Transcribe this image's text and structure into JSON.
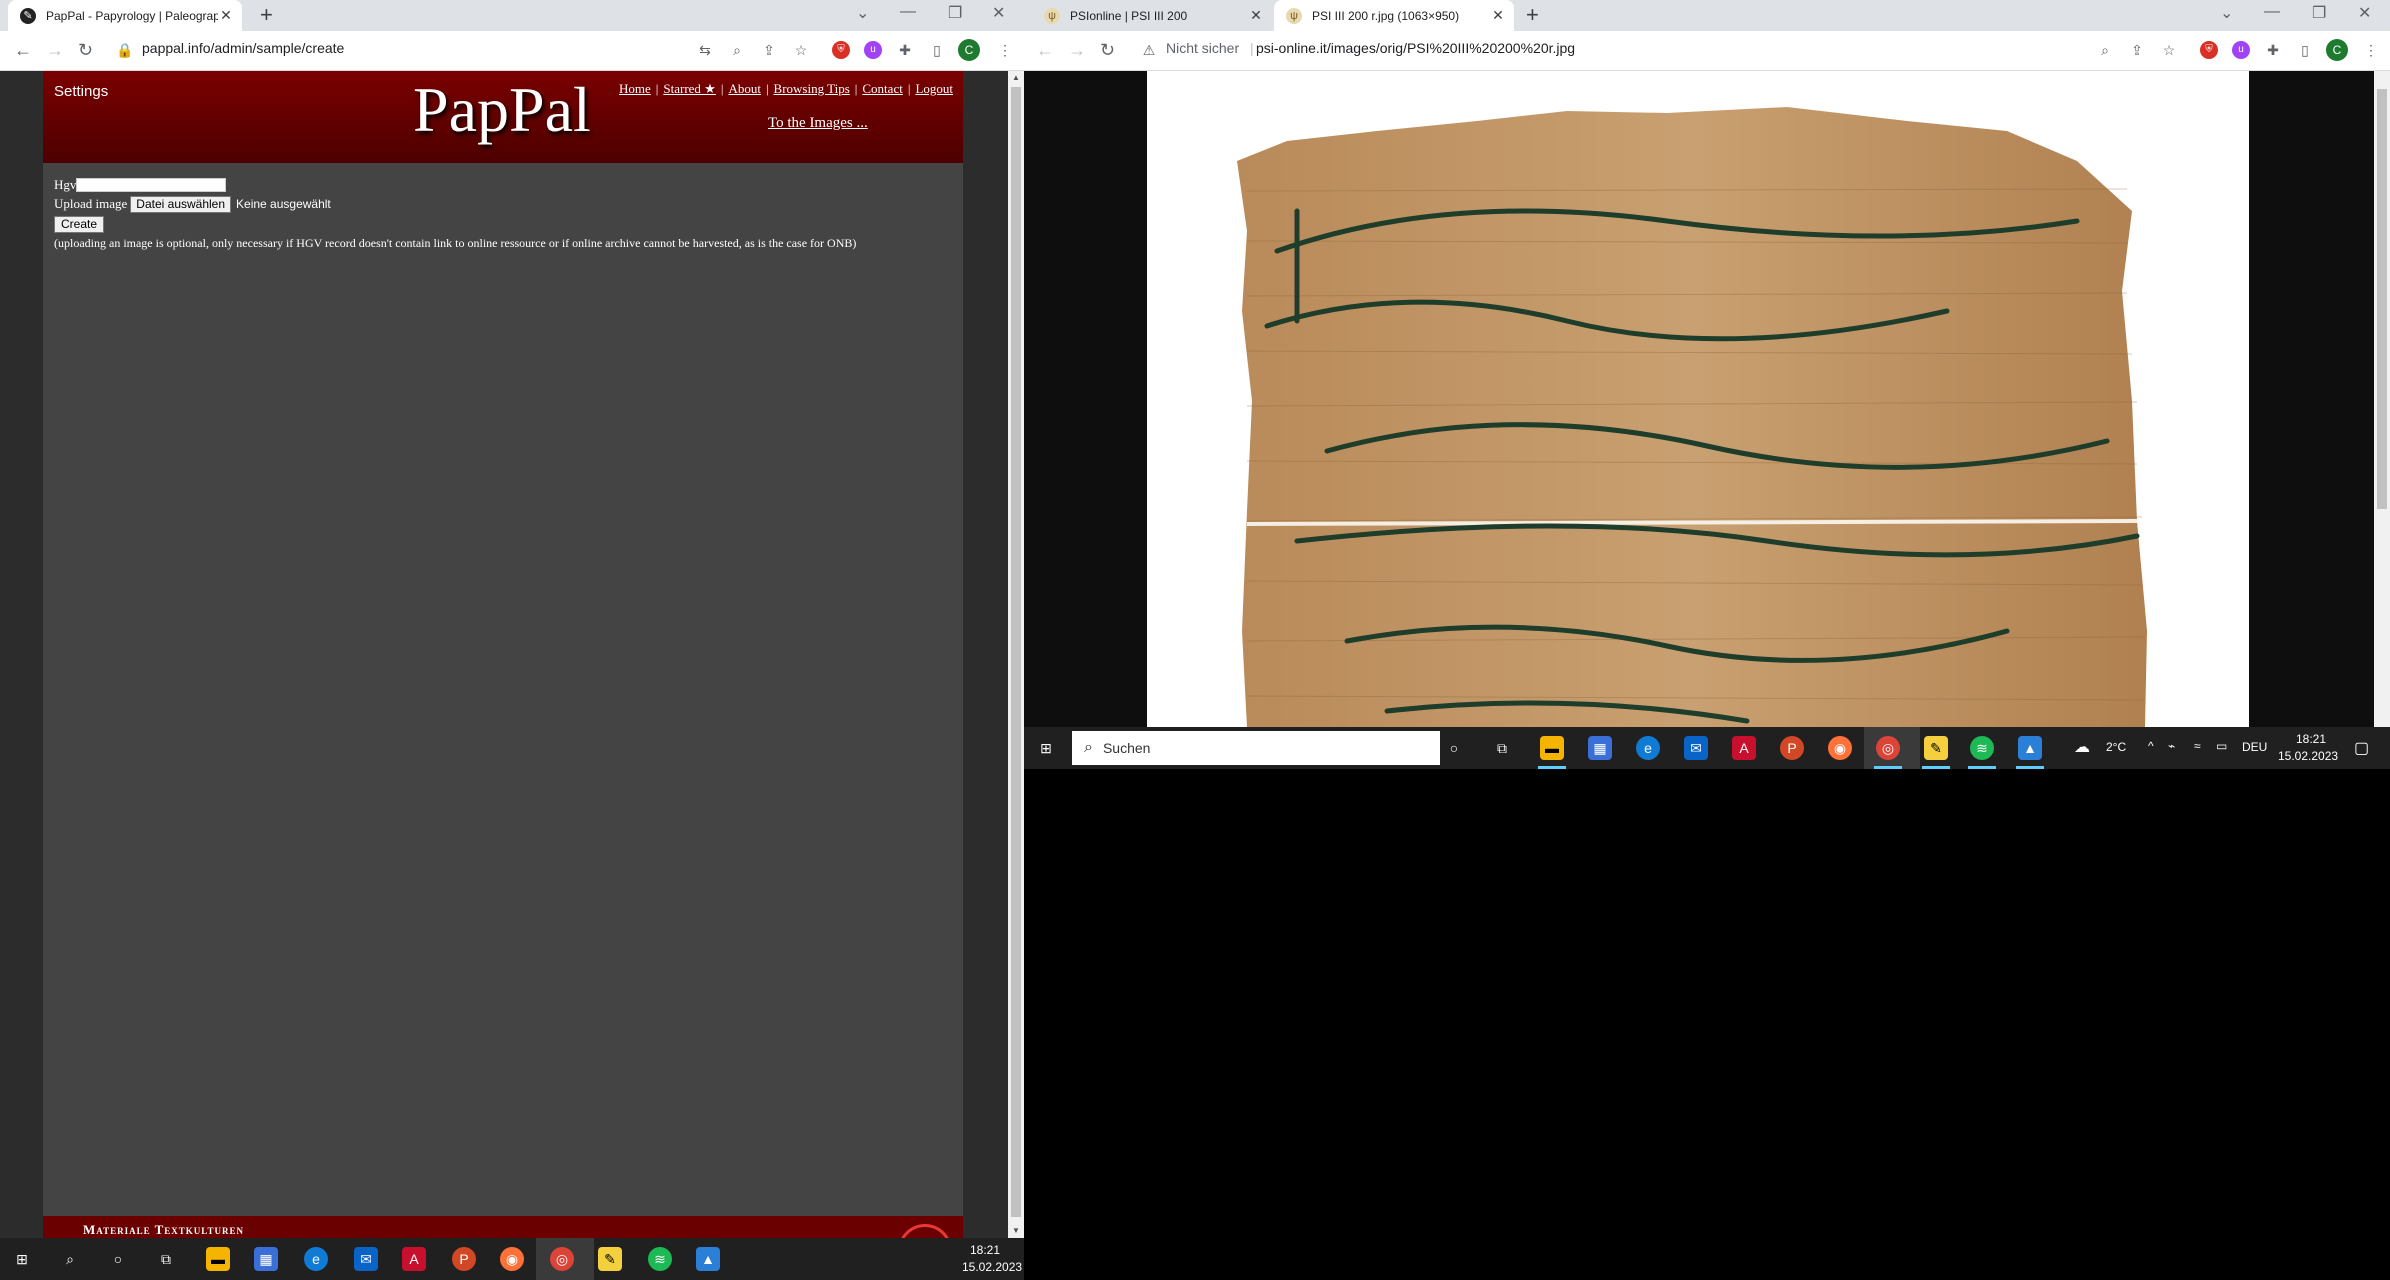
{
  "left_window": {
    "tab": {
      "title": "PapPal - Papyrology | Paleograph"
    },
    "url": "pappal.info/admin/sample/create",
    "page": {
      "settings": "Settings",
      "logo": "PapPal",
      "nav": [
        "Home",
        "Starred ★",
        "About",
        "Browsing Tips",
        "Contact",
        "Logout"
      ],
      "to_images": "To the Images ...",
      "form": {
        "hgv_label": "Hgv",
        "hgv_value": "",
        "upload_label": "Upload image",
        "file_button": "Datei auswählen",
        "file_status": "Keine ausgewählt",
        "create_button": "Create",
        "note": "(uploading an image is optional, only necessary if HGV record doesn't contain link to online ressource or if online archive cannot be harvested, as is the case for ONB)"
      },
      "footer": "Materiale Textkulturen"
    },
    "taskbar": {
      "time": "18:21",
      "date": "15.02.2023"
    }
  },
  "right_window": {
    "tabs": [
      {
        "title": "PSIonline | PSI III 200"
      },
      {
        "title": "PSI III 200 r.jpg (1063×950)"
      }
    ],
    "security": "Nicht sicher",
    "url": "psi-online.it/images/orig/PSI%20III%20200%20r.jpg",
    "taskbar": {
      "search": "Suchen",
      "weather": "2°C",
      "lang": "DEU",
      "time": "18:21",
      "date": "15.02.2023"
    }
  },
  "colors": {
    "header_red": "#6b0000",
    "page_gray": "#444444",
    "papyrus": "#c49a6c",
    "ink": "#1f3d2b"
  }
}
